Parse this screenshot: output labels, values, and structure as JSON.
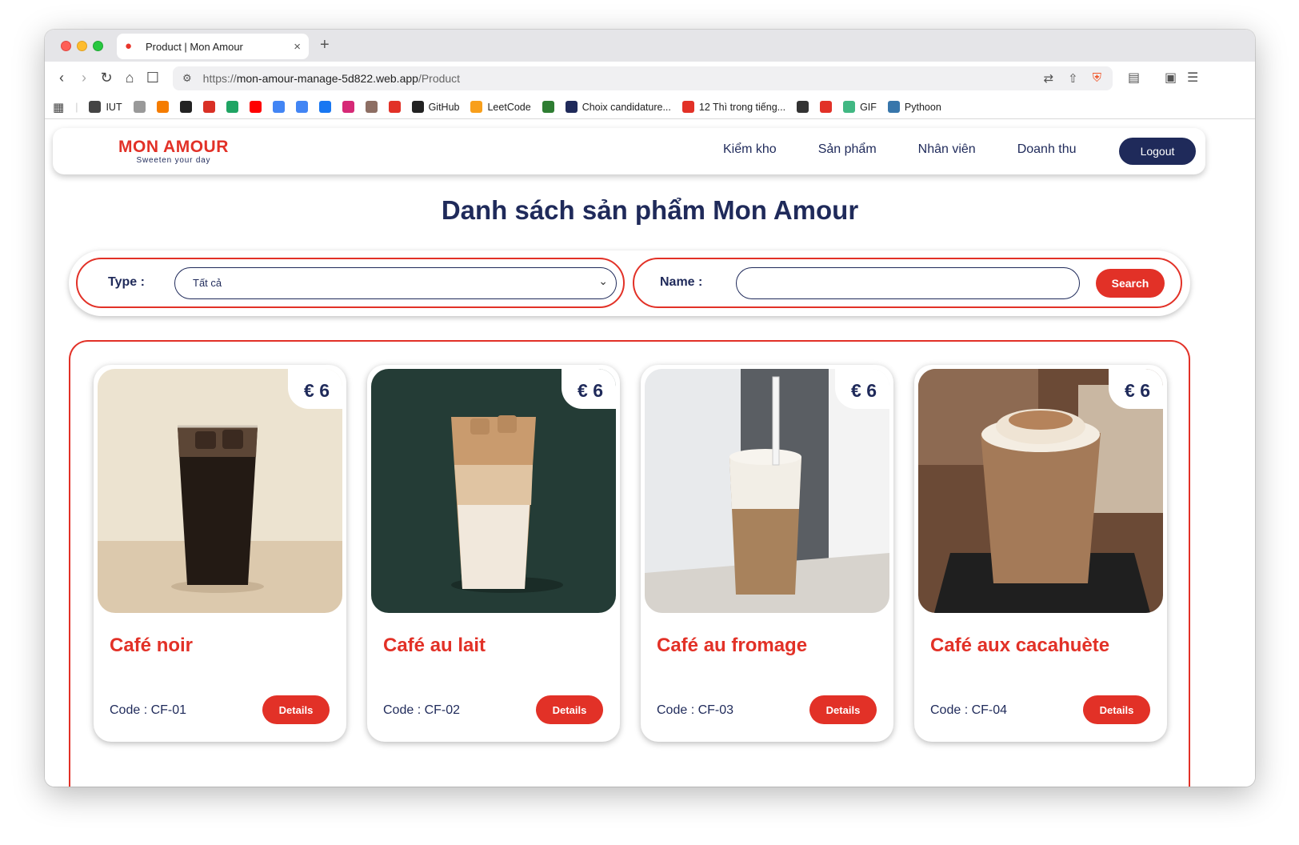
{
  "browser": {
    "tab_title": "Product | Mon Amour",
    "new_tab": "+",
    "close_tab": "×",
    "url_prefix": "https://",
    "url_host": "mon-amour-manage-5d822.web.app",
    "url_path": "/Product"
  },
  "bookmarks": [
    {
      "label": "IUT",
      "icon": "globe-icon",
      "color": "#444"
    },
    {
      "label": "",
      "icon": "bookmark-icon",
      "color": "#999"
    },
    {
      "label": "",
      "icon": "fire-icon",
      "color": "#f57c00"
    },
    {
      "label": "",
      "icon": "openai-icon",
      "color": "#222"
    },
    {
      "label": "",
      "icon": "gmail-icon",
      "color": "#d93025"
    },
    {
      "label": "",
      "icon": "drive-icon",
      "color": "#1fa463"
    },
    {
      "label": "",
      "icon": "youtube-icon",
      "color": "#ff0000"
    },
    {
      "label": "",
      "icon": "docs-icon",
      "color": "#4285f4"
    },
    {
      "label": "",
      "icon": "translate-icon",
      "color": "#4285f4"
    },
    {
      "label": "",
      "icon": "facebook-icon",
      "color": "#1877f2"
    },
    {
      "label": "",
      "icon": "instagram-icon",
      "color": "#d62976"
    },
    {
      "label": "",
      "icon": "plant-icon",
      "color": "#8d6e63"
    },
    {
      "label": "",
      "icon": "cloud-icon",
      "color": "#e23127"
    },
    {
      "label": "GitHub",
      "icon": "github-icon",
      "color": "#222"
    },
    {
      "label": "LeetCode",
      "icon": "leetcode-icon",
      "color": "#f89f1b"
    },
    {
      "label": "",
      "icon": "w-icon",
      "color": "#2e7d32"
    },
    {
      "label": "Choix candidature...",
      "icon": "feather-icon",
      "color": "#1f2a5a"
    },
    {
      "label": "12 Thì trong tiếng...",
      "icon": "circle-icon",
      "color": "#e23127"
    },
    {
      "label": "",
      "icon": "sites-icon",
      "color": "#333"
    },
    {
      "label": "",
      "icon": "square-icon",
      "color": "#e23127"
    },
    {
      "label": "GIF",
      "icon": "vue-icon",
      "color": "#41b883"
    },
    {
      "label": "Pythoon",
      "icon": "python-icon",
      "color": "#3776ab"
    }
  ],
  "header": {
    "logo_text": "MON AMOUR",
    "logo_tagline": "Sweeten your day",
    "menu": [
      "Kiểm kho",
      "Sản phẩm",
      "Nhân viên",
      "Doanh thu"
    ],
    "logout_label": "Logout"
  },
  "page_title": "Danh sách sản phẩm Mon Amour",
  "filters": {
    "type_label": "Type :",
    "type_value": "Tất cả",
    "name_label": "Name :",
    "name_value": "",
    "search_label": "Search"
  },
  "products": [
    {
      "name": "Café noir",
      "code": "Code : CF-01",
      "price": "€ 6",
      "details_label": "Details",
      "image": "iced-black-coffee"
    },
    {
      "name": "Café au lait",
      "code": "Code : CF-02",
      "price": "€ 6",
      "details_label": "Details",
      "image": "iced-latte"
    },
    {
      "name": "Café au fromage",
      "code": "Code : CF-03",
      "price": "€ 6",
      "details_label": "Details",
      "image": "cheese-foam-coffee"
    },
    {
      "name": "Café aux cacahuète",
      "code": "Code : CF-04",
      "price": "€ 6",
      "details_label": "Details",
      "image": "peanut-cream-coffee"
    }
  ],
  "colors": {
    "brand_red": "#e23127",
    "brand_navy": "#1f2a5a"
  }
}
